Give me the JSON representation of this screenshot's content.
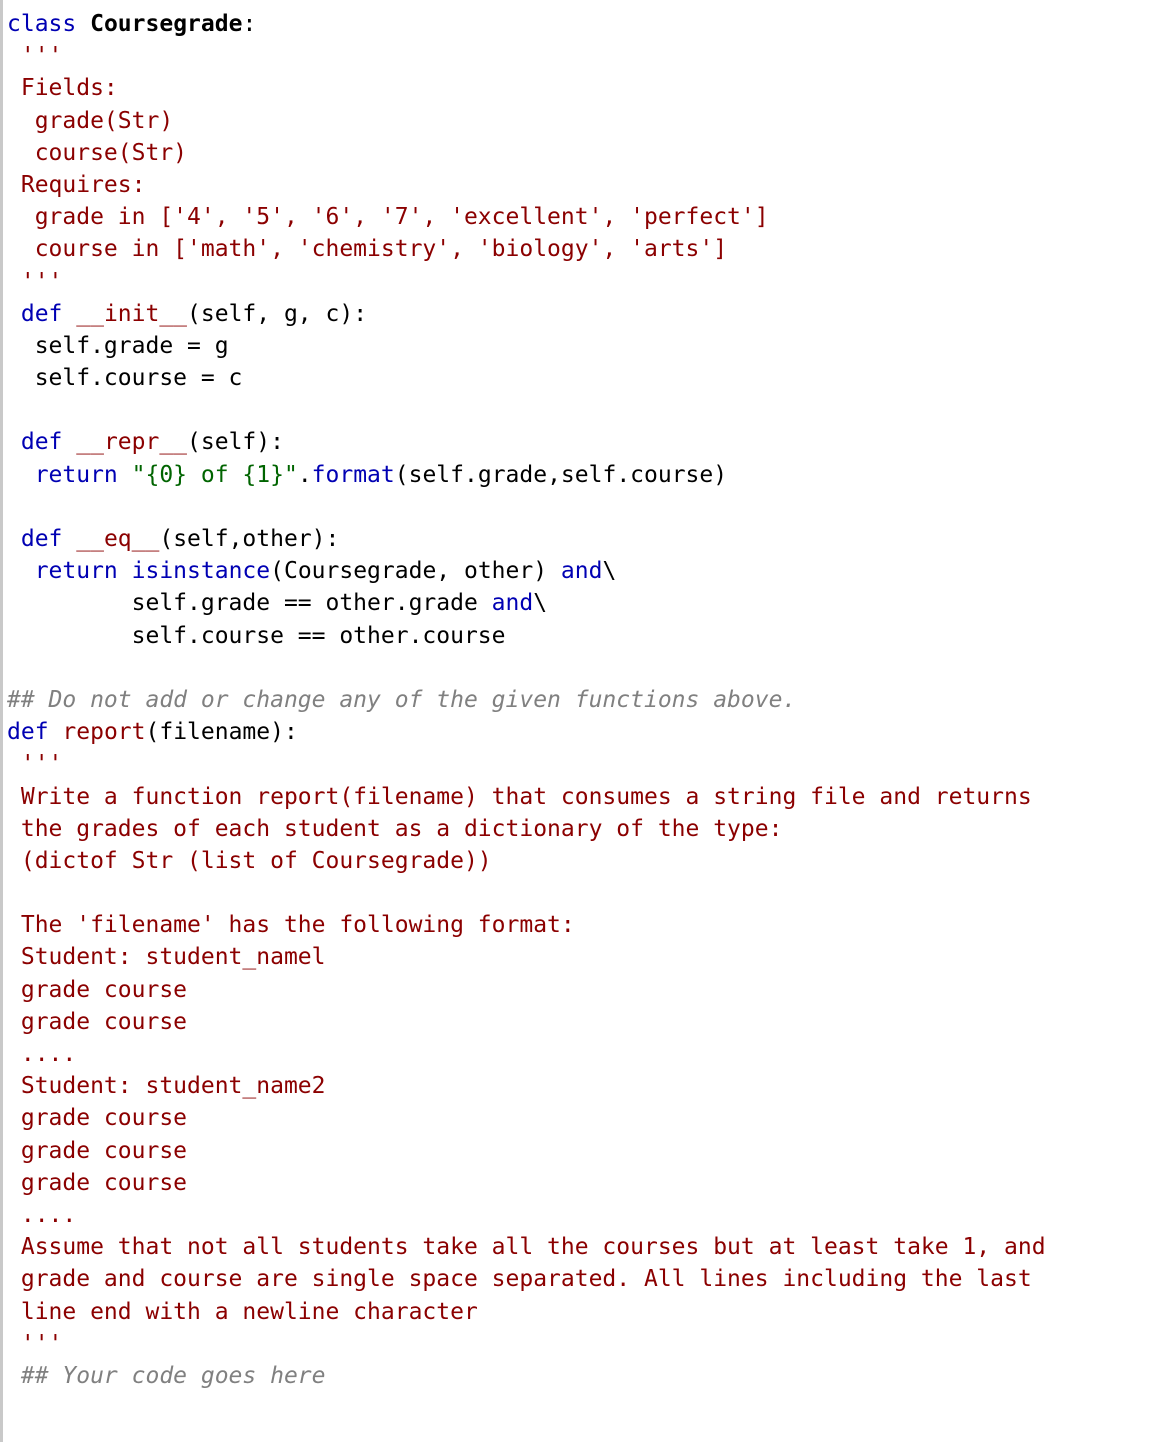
{
  "code": {
    "l01a": "class",
    "l01b": "Coursegrade",
    "l01c": ":",
    "l02": " '''",
    "l03": " Fields:",
    "l04": "  grade(Str)",
    "l05": "  course(Str)",
    "l06": " Requires:",
    "l07": "  grade in ['4', '5', '6', '7', 'excellent', 'perfect']",
    "l08": "  course in ['math', 'chemistry', 'biology', 'arts']",
    "l09": " '''",
    "l10a": " def",
    "l10b": "__init__",
    "l10c": "(self, g, c):",
    "l11": "  self.grade = g",
    "l12": "  self.course = c",
    "l13": "",
    "l14a": " def",
    "l14b": "__repr__",
    "l14c": "(self):",
    "l15a": "  return",
    "l15b": "\"{0} of {1}\"",
    "l15c": ".",
    "l15d": "format",
    "l15e": "(self.grade,self.course)",
    "l16": "",
    "l17a": " def",
    "l17b": "__eq__",
    "l17c": "(self,other):",
    "l18a": "  return",
    "l18b": "isinstance",
    "l18c": "(Coursegrade, other) ",
    "l18d": "and",
    "l18e": "\\",
    "l19a": "         self.grade == other.grade ",
    "l19b": "and",
    "l19c": "\\",
    "l20": "         self.course == other.course",
    "l21": "",
    "l22": "## Do not add or change any of the given functions above.",
    "l23a": "def",
    "l23b": "report",
    "l23c": "(filename):",
    "l24": " '''",
    "l25": " Write a function report(filename) that consumes a string file and returns",
    "l26": " the grades of each student as a dictionary of the type:",
    "l27": " (dictof Str (list of Coursegrade))",
    "l28": "",
    "l29": " The 'filename' has the following format:",
    "l30": " Student: student_namel",
    "l31": " grade course",
    "l32": " grade course",
    "l33": " ....",
    "l34": " Student: student_name2",
    "l35": " grade course",
    "l36": " grade course",
    "l37": " grade course",
    "l38": " ....",
    "l39": " Assume that not all students take all the courses but at least take 1, and",
    "l40": " grade and course are single space separated. All lines including the last",
    "l41": " line end with a newline character",
    "l42": " '''",
    "l43": " ## Your code goes here"
  }
}
